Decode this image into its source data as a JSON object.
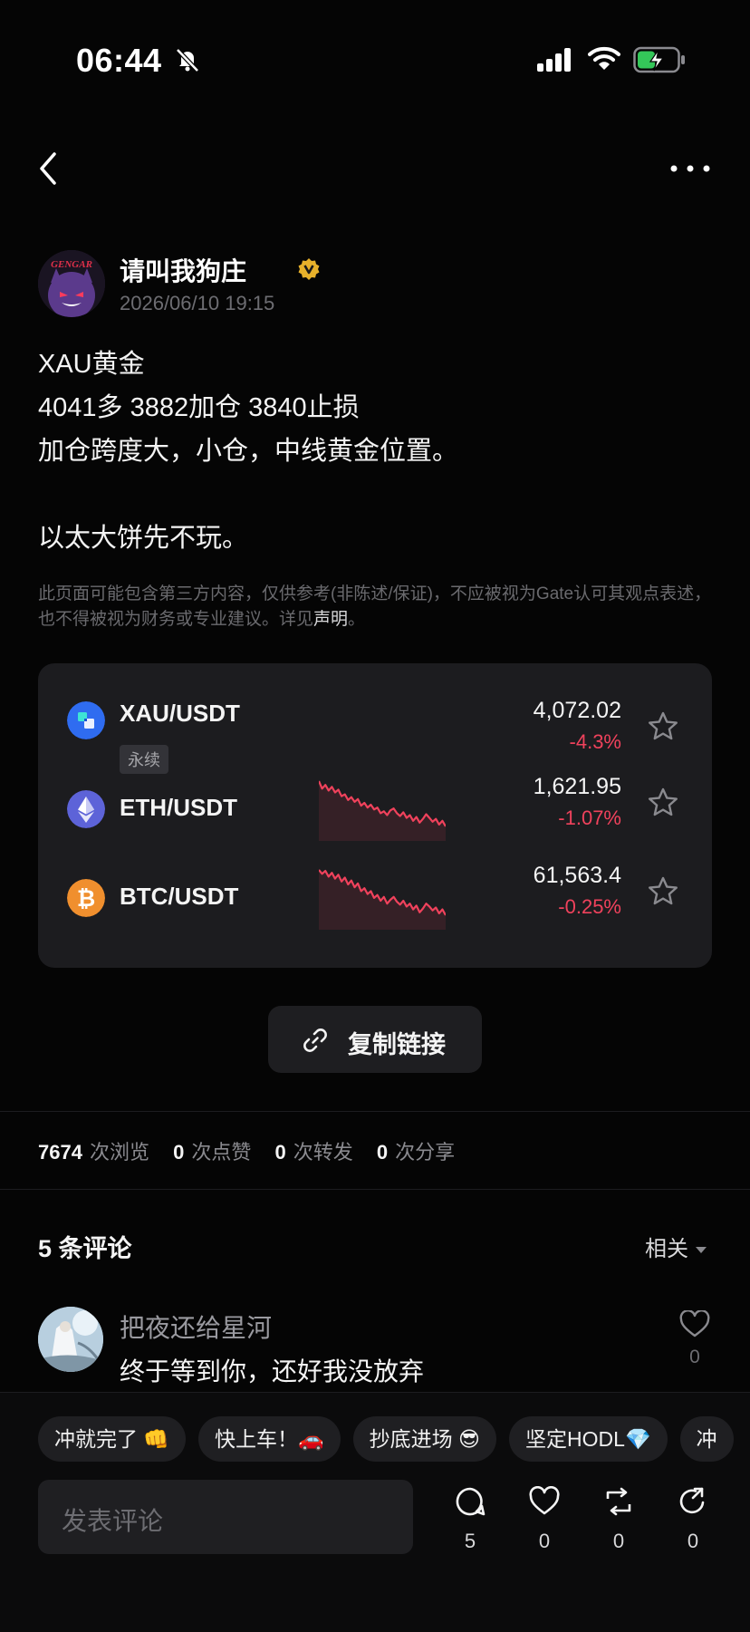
{
  "status_bar": {
    "time": "06:44"
  },
  "author": {
    "name": "请叫我狗庄",
    "time": "2026/06/10 19:15",
    "avatar_text": "GENGAR"
  },
  "post": {
    "lines": [
      "XAU黄金",
      "4041多 3882加仓 3840止损",
      "加仓跨度大，小仓，中线黄金位置。"
    ],
    "final_line": "以太大饼先不玩。"
  },
  "disclaimer": {
    "text": "此页面可能包含第三方内容，仅供参考(非陈述/保证)，不应被视为Gate认可其观点表述，也不得被视为财务或专业建议。详见",
    "link": "声明",
    "end": "。"
  },
  "markets": [
    {
      "pair": "XAU/USDT",
      "tag": "永续",
      "price": "4,072.02",
      "change": "-4.3%",
      "icon": "xau-icon",
      "color": "#2f6cf0"
    },
    {
      "pair": "ETH/USDT",
      "tag": "",
      "price": "1,621.95",
      "change": "-1.07%",
      "icon": "eth-icon",
      "color": "#5d63d8",
      "sparkline": [
        10,
        18,
        14,
        20,
        16,
        22,
        19,
        26,
        24,
        30,
        27,
        32,
        29,
        36,
        33,
        38,
        35,
        40,
        38,
        44,
        42,
        46,
        41,
        39,
        44,
        47,
        43,
        49,
        46,
        52,
        48,
        54,
        50,
        45,
        49,
        53,
        50,
        56,
        52,
        58
      ]
    },
    {
      "pair": "BTC/USDT",
      "tag": "",
      "price": "61,563.4",
      "change": "-0.25%",
      "icon": "btc-icon",
      "color": "#f08f2e",
      "sparkline": [
        12,
        16,
        13,
        19,
        15,
        21,
        17,
        24,
        20,
        27,
        23,
        30,
        26,
        34,
        31,
        37,
        34,
        41,
        38,
        44,
        40,
        47,
        43,
        40,
        45,
        48,
        44,
        50,
        47,
        53,
        49,
        56,
        52,
        47,
        50,
        54,
        51,
        57,
        53,
        59
      ]
    }
  ],
  "copy_link": "复制链接",
  "stats": [
    {
      "num": "7674",
      "unit": "次浏览"
    },
    {
      "num": "0",
      "unit": "次点赞"
    },
    {
      "num": "0",
      "unit": "次转发"
    },
    {
      "num": "0",
      "unit": "次分享"
    }
  ],
  "comments": {
    "title": "5 条评论",
    "sort": "相关",
    "items": [
      {
        "name": "把夜还给星河",
        "text": "终于等到你，还好我没放弃",
        "likes": "0"
      }
    ]
  },
  "quick_replies": [
    "冲就完了 👊",
    "快上车！🚗",
    "抄底进场 😎",
    "坚定HODL💎",
    "冲"
  ],
  "composer": {
    "placeholder": "发表评论"
  },
  "actions": [
    {
      "icon": "comment-icon",
      "count": "5"
    },
    {
      "icon": "heart-icon",
      "count": "0"
    },
    {
      "icon": "repost-icon",
      "count": "0"
    },
    {
      "icon": "share-icon",
      "count": "0"
    }
  ],
  "colors": {
    "down": "#f0425c",
    "background": "#050505",
    "card": "#1c1c1f"
  }
}
